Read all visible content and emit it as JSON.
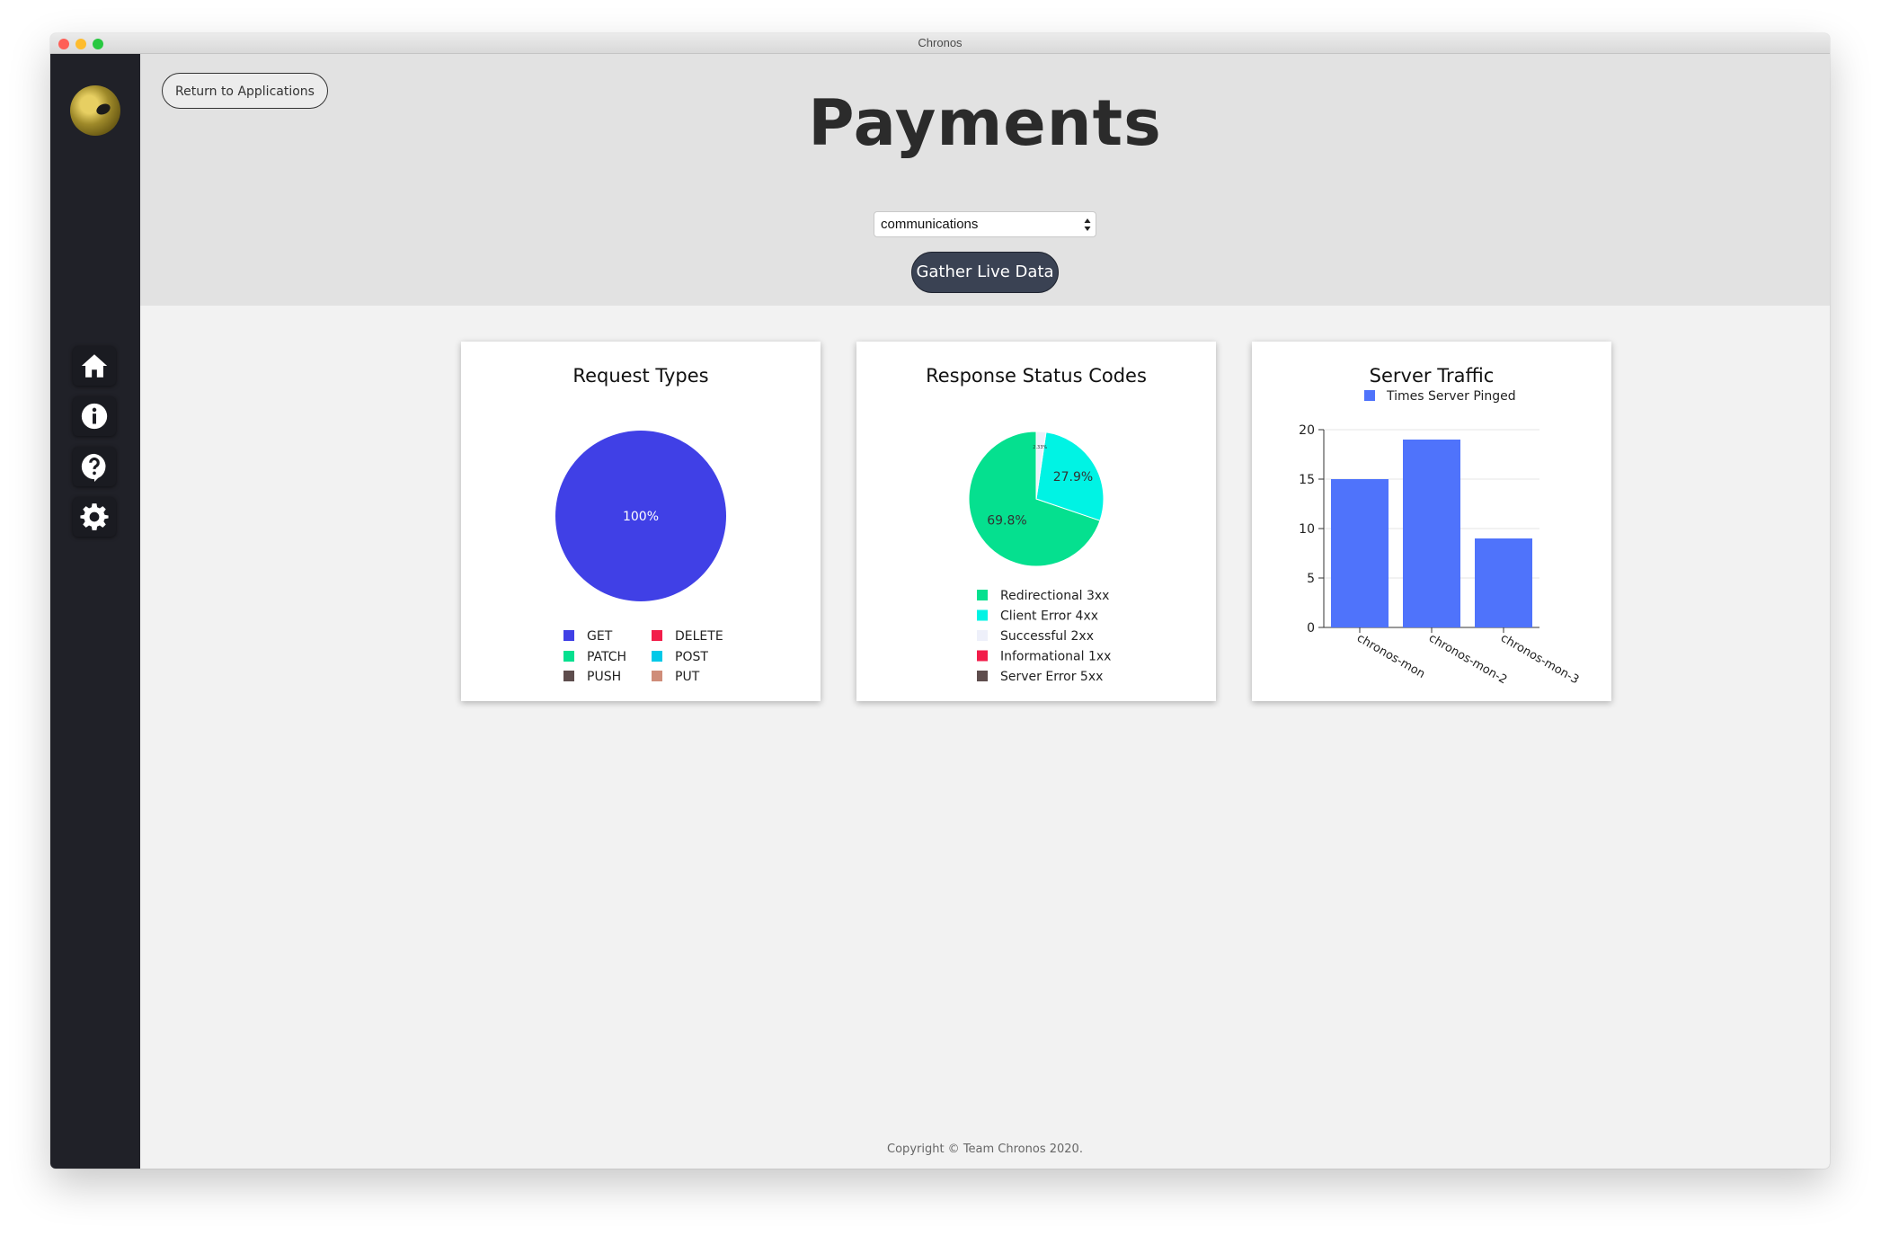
{
  "window": {
    "title": "Chronos"
  },
  "sidebar": {
    "avatar": "chronos-logo",
    "items": [
      {
        "icon": "home-icon"
      },
      {
        "icon": "info-icon"
      },
      {
        "icon": "help-icon"
      },
      {
        "icon": "gear-icon"
      }
    ]
  },
  "header": {
    "return_label": "Return to Applications",
    "title": "Payments",
    "select_value": "communications",
    "gather_label": "Gather Live Data"
  },
  "footer": {
    "copyright": "Copyright © Team Chronos 2020."
  },
  "chart_data": [
    {
      "type": "pie",
      "title": "Request Types",
      "labels": [
        "GET",
        "DELETE",
        "PATCH",
        "POST",
        "PUSH",
        "PUT"
      ],
      "values": [
        100,
        0,
        0,
        0,
        0,
        0
      ],
      "slice_labels": [
        "100%"
      ],
      "colors": [
        "#4040e6",
        "#f21d4a",
        "#05e08f",
        "#00c9e8",
        "#5e4d4d",
        "#cf8d79"
      ],
      "legend_placement": "bottom"
    },
    {
      "type": "pie",
      "title": "Response Status Codes",
      "labels": [
        "Redirectional 3xx",
        "Client Error 4xx",
        "Successful 2xx",
        "Informational 1xx",
        "Server Error 5xx"
      ],
      "values": [
        69.8,
        27.9,
        2.33,
        0,
        0
      ],
      "slice_labels": [
        "69.8%",
        "27.9%",
        "2.33%"
      ],
      "colors": [
        "#05e08f",
        "#00f3e4",
        "#eef0fa",
        "#f21d4a",
        "#5e4d4d"
      ],
      "legend_placement": "bottom"
    },
    {
      "type": "bar",
      "title": "Server Traffic",
      "categories": [
        "chronos-mon",
        "chronos-mon-2",
        "chronos-mon-3"
      ],
      "series": [
        {
          "name": "Times Server Pinged",
          "values": [
            15,
            19,
            9
          ]
        }
      ],
      "ylim": [
        0,
        20
      ],
      "yticks": [
        "0",
        "5",
        "10",
        "15",
        "20"
      ],
      "color": "#4f73fb",
      "grid": true,
      "legend_placement": "top"
    }
  ]
}
